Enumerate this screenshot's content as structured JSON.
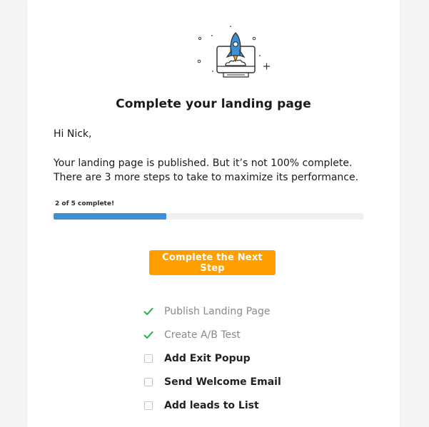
{
  "email": {
    "title": "Complete your landing page",
    "greeting": "Hi Nick,",
    "message_line1": "Your landing page is published. But it’s not 100% complete.",
    "message_line2": "There are 3 more steps to take to maximize its performance.",
    "progress": {
      "label": "2 of 5 complete!",
      "fraction": 0.364
    },
    "cta_label": "Complete the Next Step",
    "steps": [
      {
        "label": "Publish Landing Page",
        "status": "done"
      },
      {
        "label": "Create A/B Test",
        "status": "done"
      },
      {
        "label": "Add Exit Popup",
        "status": "todo"
      },
      {
        "label": "Send Welcome Email",
        "status": "todo"
      },
      {
        "label": "Add leads to List",
        "status": "todo"
      }
    ]
  },
  "icons": {
    "hero": "rocket-monitor-icon",
    "done": "checkmark-icon",
    "todo": "empty-checkbox-icon"
  },
  "colors": {
    "accent_button": "#ff9f00",
    "progress_fill": "#3d8fd6",
    "check": "#22b24c"
  }
}
